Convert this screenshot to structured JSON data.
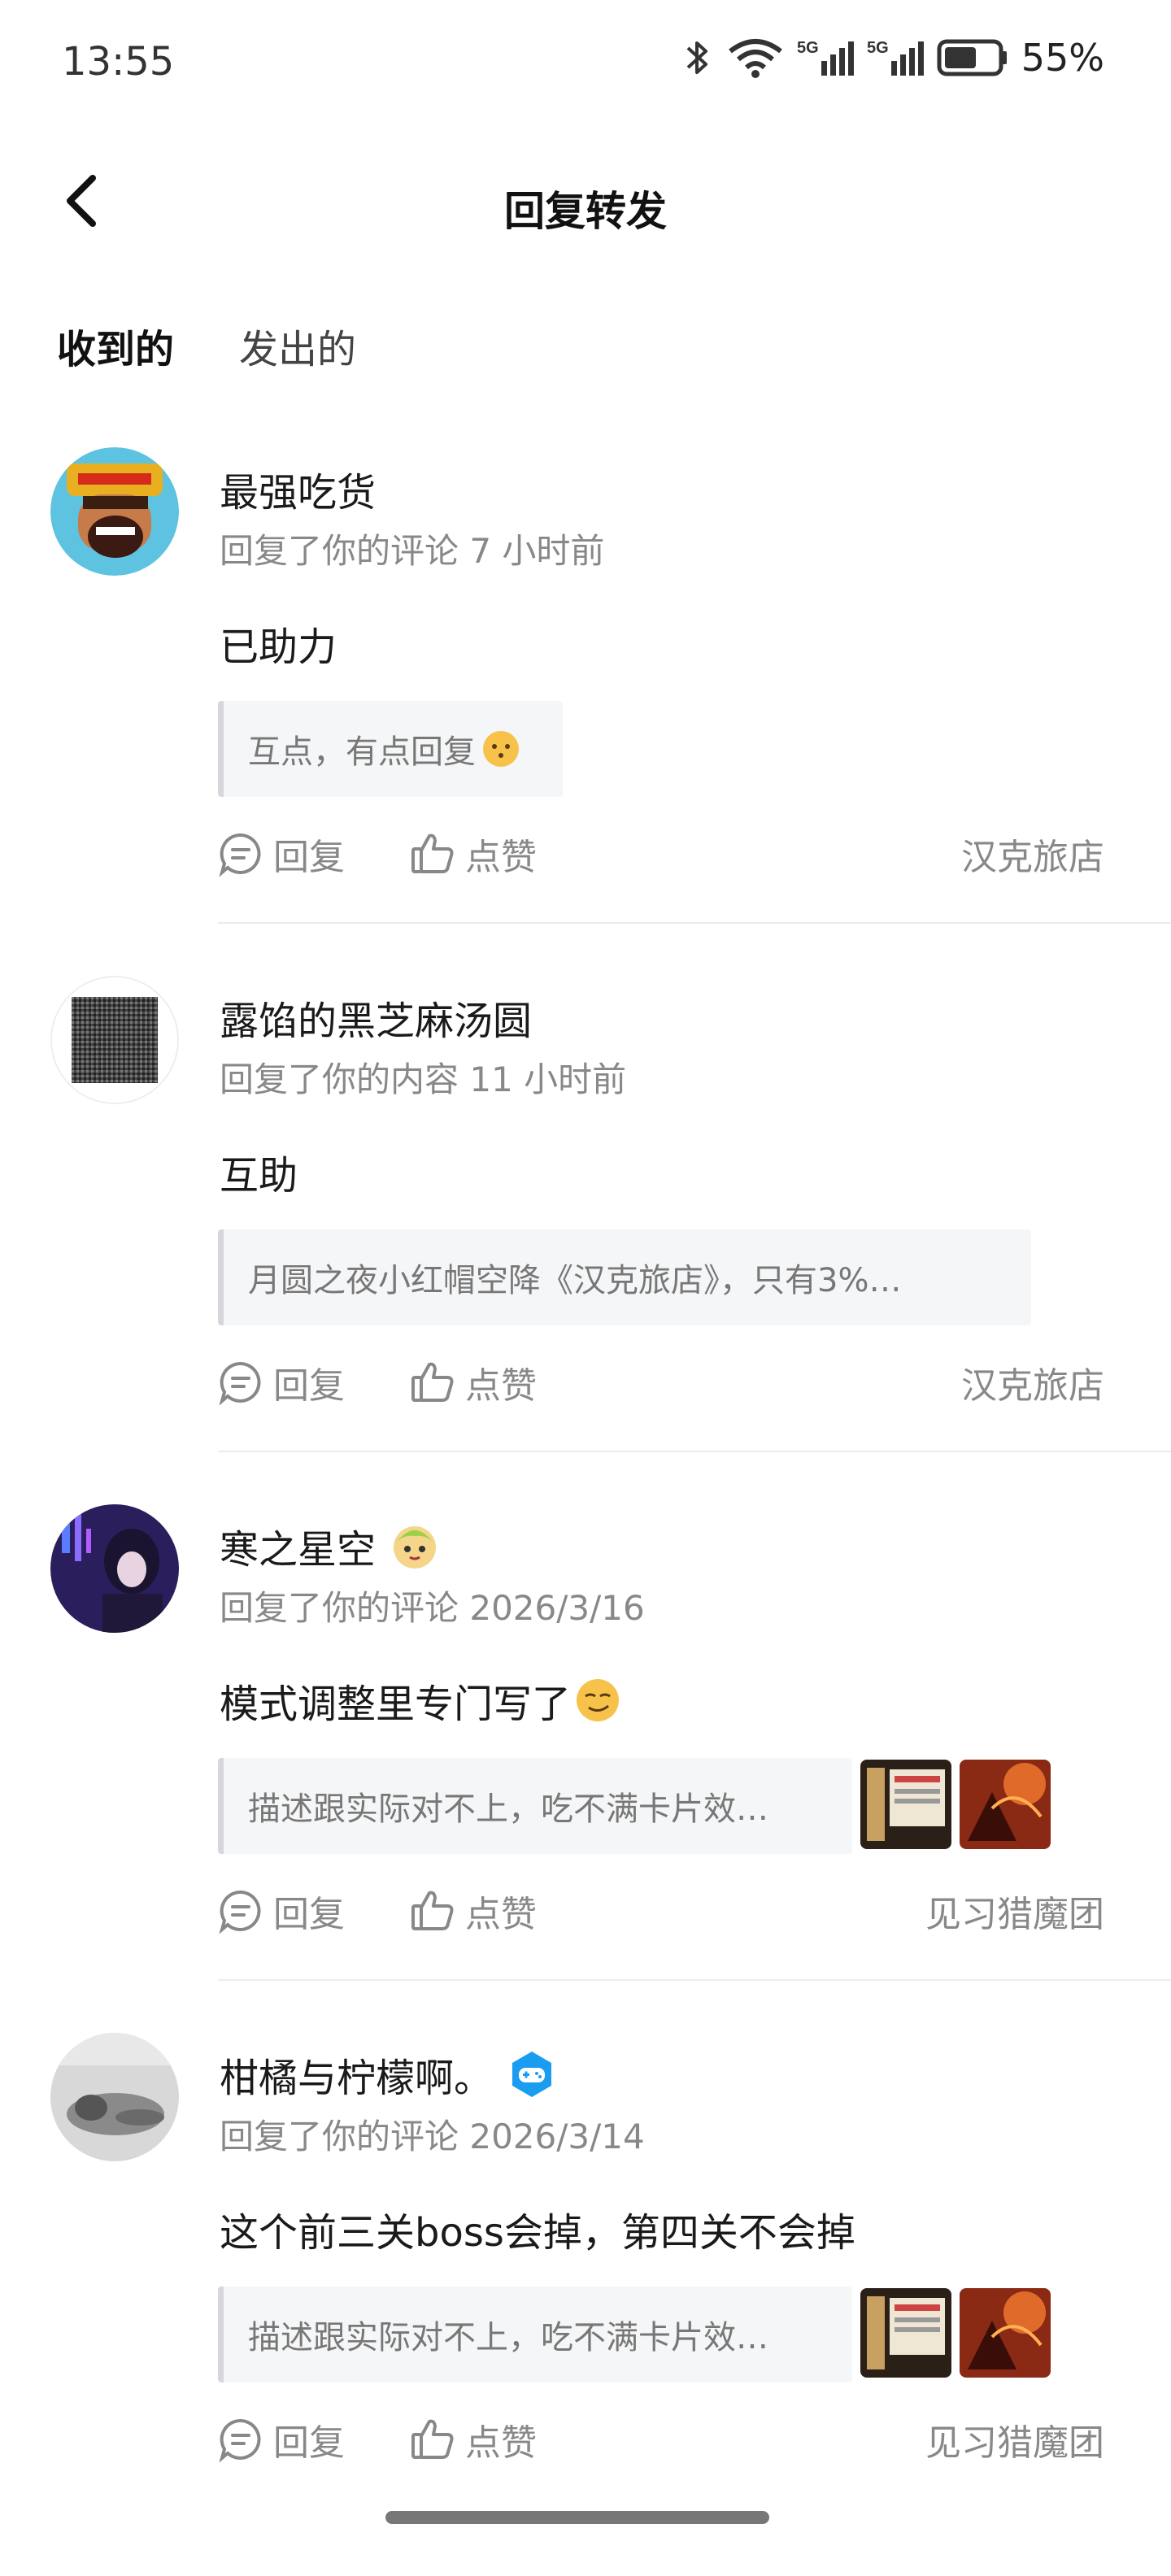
{
  "status_bar": {
    "time": "13:55",
    "battery_pct": "55%",
    "network": "5G"
  },
  "header": {
    "title": "回复转发"
  },
  "tabs": [
    {
      "label": "收到的"
    },
    {
      "label": "发出的"
    }
  ],
  "actions": {
    "reply_label": "回复",
    "like_label": "点赞"
  },
  "items": [
    {
      "name": "最强吃货",
      "meta": "回复了你的评论 7 小时前",
      "content": "已助力",
      "quote": "互点，有点回复",
      "tag": "汉克旅店"
    },
    {
      "name": "露馅的黑芝麻汤圆",
      "meta": "回复了你的内容 11 小时前",
      "content": "互助",
      "quote": "月圆之夜小红帽空降《汉克旅店》，只有3%…",
      "tag": "汉克旅店"
    },
    {
      "name": "寒之星空",
      "meta": "回复了你的评论 2026/3/16",
      "content": "模式调整里专门写了",
      "quote": "描述跟实际对不上，吃不满卡片效…",
      "tag": "见习猎魔团"
    },
    {
      "name": "柑橘与柠檬啊。",
      "meta": "回复了你的评论 2026/3/14",
      "content": "这个前三关boss会掉，第四关不会掉",
      "quote": "描述跟实际对不上，吃不满卡片效…",
      "tag": "见习猎魔团"
    }
  ],
  "colors": {
    "accent": "#27c7b1",
    "muted": "#888888"
  }
}
